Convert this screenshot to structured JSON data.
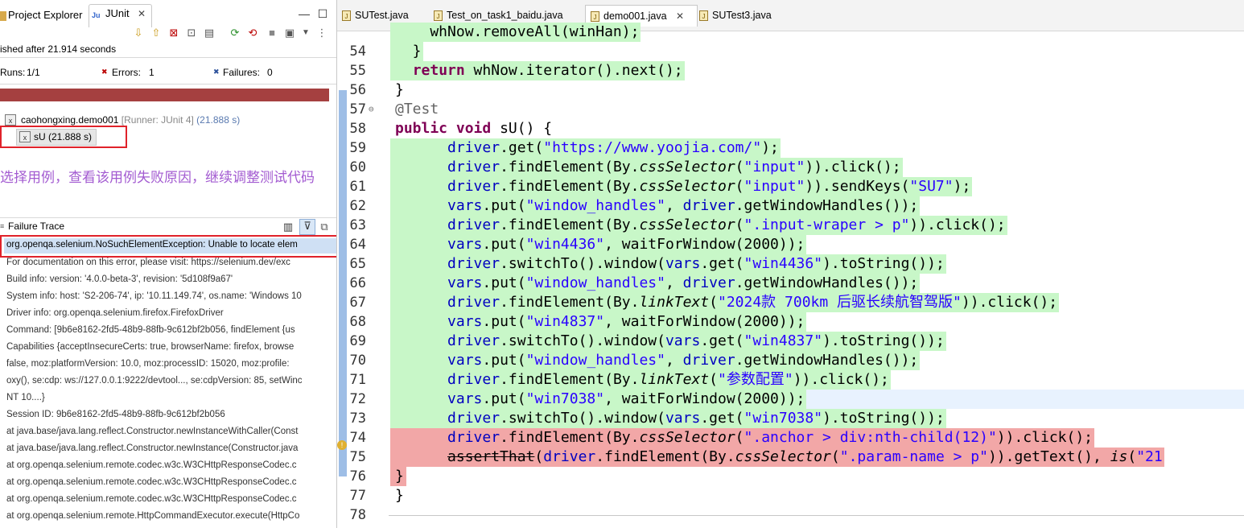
{
  "left_panel": {
    "tabs": [
      {
        "label": "Project Explorer",
        "icon": "project-explorer-icon"
      },
      {
        "label": "JUnit",
        "icon": "junit-icon"
      }
    ],
    "close_glyph": "✕",
    "minimize_glyph": "—",
    "maximize_glyph": "☐",
    "status": "ished after 21.914 seconds",
    "runs_label": "Runs:",
    "runs_value": "1/1",
    "errors_label": "Errors:",
    "errors_value": "1",
    "failures_label": "Failures:",
    "failures_value": "0",
    "progress_color": "#a54040",
    "tree_root": "caohongxing.demo001",
    "tree_root_runner": "[Runner: JUnit 4]",
    "tree_root_time": "(21.888 s)",
    "tree_child": "sU (21.888 s)",
    "annotation": "选择用例，查看该用例失败原因，继续调整测试代码",
    "failure_trace_label": "Failure Trace",
    "trace_lines": [
      "org.openqa.selenium.NoSuchElementException: Unable to locate elem",
      "For documentation on this error, please visit: https://selenium.dev/exc",
      "Build info: version: '4.0.0-beta-3', revision: '5d108f9a67'",
      "System info: host: 'S2-206-74', ip: '10.11.149.74', os.name: 'Windows 10",
      "Driver info: org.openqa.selenium.firefox.FirefoxDriver",
      "Command: [9b6e8162-2fd5-48b9-88fb-9c612bf2b056, findElement {us",
      "Capabilities {acceptInsecureCerts: true, browserName: firefox, browse",
      " false, moz:platformVersion: 10.0, moz:processID: 15020, moz:profile:",
      "oxy(), se:cdp: ws://127.0.0.1:9222/devtool..., se:cdpVersion: 85, setWinc",
      "NT 10....}",
      "Session ID: 9b6e8162-2fd5-48b9-88fb-9c612bf2b056",
      "at java.base/java.lang.reflect.Constructor.newInstanceWithCaller(Const",
      "at java.base/java.lang.reflect.Constructor.newInstance(Constructor.java",
      "at org.openqa.selenium.remote.codec.w3c.W3CHttpResponseCodec.c",
      "at org.openqa.selenium.remote.codec.w3c.W3CHttpResponseCodec.c",
      "at org.openqa.selenium.remote.codec.w3c.W3CHttpResponseCodec.c",
      "at org.openqa.selenium.remote.HttpCommandExecutor.execute(HttpCo"
    ]
  },
  "editor": {
    "tabs": [
      {
        "label": "SUTest.java",
        "active": false
      },
      {
        "label": "Test_on_task1_baidu.java",
        "active": false
      },
      {
        "label": "demo001.java",
        "active": true,
        "close": "✕"
      },
      {
        "label": "SUTest3.java",
        "active": false
      }
    ],
    "lines": [
      {
        "n": "",
        "hl": "green",
        "parts": [
          [
            "    whNow.removeAll(winHan);",
            ""
          ]
        ]
      },
      {
        "n": "54",
        "hl": "green",
        "parts": [
          [
            "  }",
            ""
          ]
        ]
      },
      {
        "n": "55",
        "hl": "green",
        "parts": [
          [
            "  ",
            ""
          ],
          [
            "return",
            "kw"
          ],
          [
            " whNow.iterator().next();",
            ""
          ]
        ]
      },
      {
        "n": "56",
        "hl": "",
        "parts": [
          [
            "}",
            ""
          ]
        ]
      },
      {
        "n": "57",
        "hl": "",
        "fold": "⊖",
        "parts": [
          [
            "@Test",
            "ann"
          ]
        ]
      },
      {
        "n": "58",
        "hl": "",
        "parts": [
          [
            "public",
            "kw"
          ],
          [
            " ",
            ""
          ],
          [
            "void",
            "kw"
          ],
          [
            " sU() {",
            ""
          ]
        ]
      },
      {
        "n": "59",
        "hl": "green",
        "parts": [
          [
            "      ",
            ""
          ],
          [
            "driver",
            "fld"
          ],
          [
            ".get(",
            ""
          ],
          [
            "\"https://www.yoojia.com/\"",
            "str"
          ],
          [
            ");",
            ""
          ]
        ]
      },
      {
        "n": "60",
        "hl": "green",
        "parts": [
          [
            "      ",
            ""
          ],
          [
            "driver",
            "fld"
          ],
          [
            ".findElement(By.",
            ""
          ],
          [
            "cssSelector",
            "ital"
          ],
          [
            "(",
            ""
          ],
          [
            "\"input\"",
            "str"
          ],
          [
            ")).click();",
            ""
          ]
        ]
      },
      {
        "n": "61",
        "hl": "green",
        "parts": [
          [
            "      ",
            ""
          ],
          [
            "driver",
            "fld"
          ],
          [
            ".findElement(By.",
            ""
          ],
          [
            "cssSelector",
            "ital"
          ],
          [
            "(",
            ""
          ],
          [
            "\"input\"",
            "str"
          ],
          [
            ")).sendKeys(",
            ""
          ],
          [
            "\"SU7\"",
            "str"
          ],
          [
            ");",
            ""
          ]
        ]
      },
      {
        "n": "62",
        "hl": "green",
        "parts": [
          [
            "      ",
            ""
          ],
          [
            "vars",
            "fld"
          ],
          [
            ".put(",
            ""
          ],
          [
            "\"window_handles\"",
            "str"
          ],
          [
            ", ",
            ""
          ],
          [
            "driver",
            "fld"
          ],
          [
            ".getWindowHandles());",
            ""
          ]
        ]
      },
      {
        "n": "63",
        "hl": "green",
        "parts": [
          [
            "      ",
            ""
          ],
          [
            "driver",
            "fld"
          ],
          [
            ".findElement(By.",
            ""
          ],
          [
            "cssSelector",
            "ital"
          ],
          [
            "(",
            ""
          ],
          [
            "\".input-wraper > p\"",
            "str"
          ],
          [
            ")).click();",
            ""
          ]
        ]
      },
      {
        "n": "64",
        "hl": "green",
        "parts": [
          [
            "      ",
            ""
          ],
          [
            "vars",
            "fld"
          ],
          [
            ".put(",
            ""
          ],
          [
            "\"win4436\"",
            "str"
          ],
          [
            ", waitForWindow(2000));",
            ""
          ]
        ]
      },
      {
        "n": "65",
        "hl": "green",
        "parts": [
          [
            "      ",
            ""
          ],
          [
            "driver",
            "fld"
          ],
          [
            ".switchTo().window(",
            ""
          ],
          [
            "vars",
            "fld"
          ],
          [
            ".get(",
            ""
          ],
          [
            "\"win4436\"",
            "str"
          ],
          [
            ").toString());",
            ""
          ]
        ]
      },
      {
        "n": "66",
        "hl": "green",
        "parts": [
          [
            "      ",
            ""
          ],
          [
            "vars",
            "fld"
          ],
          [
            ".put(",
            ""
          ],
          [
            "\"window_handles\"",
            "str"
          ],
          [
            ", ",
            ""
          ],
          [
            "driver",
            "fld"
          ],
          [
            ".getWindowHandles());",
            ""
          ]
        ]
      },
      {
        "n": "67",
        "hl": "green",
        "parts": [
          [
            "      ",
            ""
          ],
          [
            "driver",
            "fld"
          ],
          [
            ".findElement(By.",
            ""
          ],
          [
            "linkText",
            "ital"
          ],
          [
            "(",
            ""
          ],
          [
            "\"2024款 700km 后驱长续航智驾版\"",
            "str"
          ],
          [
            ")).click();",
            ""
          ]
        ]
      },
      {
        "n": "68",
        "hl": "green",
        "parts": [
          [
            "      ",
            ""
          ],
          [
            "vars",
            "fld"
          ],
          [
            ".put(",
            ""
          ],
          [
            "\"win4837\"",
            "str"
          ],
          [
            ", waitForWindow(2000));",
            ""
          ]
        ]
      },
      {
        "n": "69",
        "hl": "green",
        "parts": [
          [
            "      ",
            ""
          ],
          [
            "driver",
            "fld"
          ],
          [
            ".switchTo().window(",
            ""
          ],
          [
            "vars",
            "fld"
          ],
          [
            ".get(",
            ""
          ],
          [
            "\"win4837\"",
            "str"
          ],
          [
            ").toString());",
            ""
          ]
        ]
      },
      {
        "n": "70",
        "hl": "green",
        "parts": [
          [
            "      ",
            ""
          ],
          [
            "vars",
            "fld"
          ],
          [
            ".put(",
            ""
          ],
          [
            "\"window_handles\"",
            "str"
          ],
          [
            ", ",
            ""
          ],
          [
            "driver",
            "fld"
          ],
          [
            ".getWindowHandles());",
            ""
          ]
        ]
      },
      {
        "n": "71",
        "hl": "green",
        "parts": [
          [
            "      ",
            ""
          ],
          [
            "driver",
            "fld"
          ],
          [
            ".findElement(By.",
            ""
          ],
          [
            "linkText",
            "ital"
          ],
          [
            "(",
            ""
          ],
          [
            "\"参数配置\"",
            "str"
          ],
          [
            ")).click();",
            ""
          ]
        ]
      },
      {
        "n": "72",
        "hl": "green",
        "current": true,
        "parts": [
          [
            "      ",
            ""
          ],
          [
            "vars",
            "fld"
          ],
          [
            ".put(",
            ""
          ],
          [
            "\"win7038\"",
            "str"
          ],
          [
            ", waitForWindow(2000));",
            ""
          ]
        ]
      },
      {
        "n": "73",
        "hl": "green",
        "parts": [
          [
            "      ",
            ""
          ],
          [
            "driver",
            "fld"
          ],
          [
            ".switchTo().window(",
            ""
          ],
          [
            "vars",
            "fld"
          ],
          [
            ".get(",
            ""
          ],
          [
            "\"win7038\"",
            "str"
          ],
          [
            ").toString());",
            ""
          ]
        ]
      },
      {
        "n": "74",
        "hl": "red",
        "parts": [
          [
            "      ",
            ""
          ],
          [
            "driver",
            "fld"
          ],
          [
            ".findElement(By.",
            ""
          ],
          [
            "cssSelector",
            "ital"
          ],
          [
            "(",
            ""
          ],
          [
            "\".anchor > div:nth-child(12)\"",
            "str"
          ],
          [
            ")).click();",
            ""
          ]
        ]
      },
      {
        "n": "75",
        "hl": "red",
        "parts": [
          [
            "      ",
            ""
          ],
          [
            "assertThat",
            "strike"
          ],
          [
            "(",
            ""
          ],
          [
            "driver",
            "fld"
          ],
          [
            ".findElement(By.",
            ""
          ],
          [
            "cssSelector",
            "ital"
          ],
          [
            "(",
            ""
          ],
          [
            "\".param-name > p\"",
            "str"
          ],
          [
            ")).getText(), ",
            ""
          ],
          [
            "is",
            "ital"
          ],
          [
            "(",
            ""
          ],
          [
            "\"21",
            "str"
          ]
        ]
      },
      {
        "n": "76",
        "hl": "red",
        "parts": [
          [
            "}",
            ""
          ]
        ]
      },
      {
        "n": "77",
        "hl": "",
        "parts": [
          [
            "}",
            ""
          ]
        ]
      },
      {
        "n": "78",
        "hl": "",
        "parts": [
          [
            "",
            ""
          ]
        ]
      }
    ]
  },
  "colors": {
    "green_highlight": "#c8f7c8",
    "red_highlight": "#f2a7a7",
    "keyword": "#7f0055",
    "string": "#2a00ff",
    "field": "#0000c0",
    "annotation_text": "#a35bd1",
    "callout_box": "#e0222a"
  }
}
